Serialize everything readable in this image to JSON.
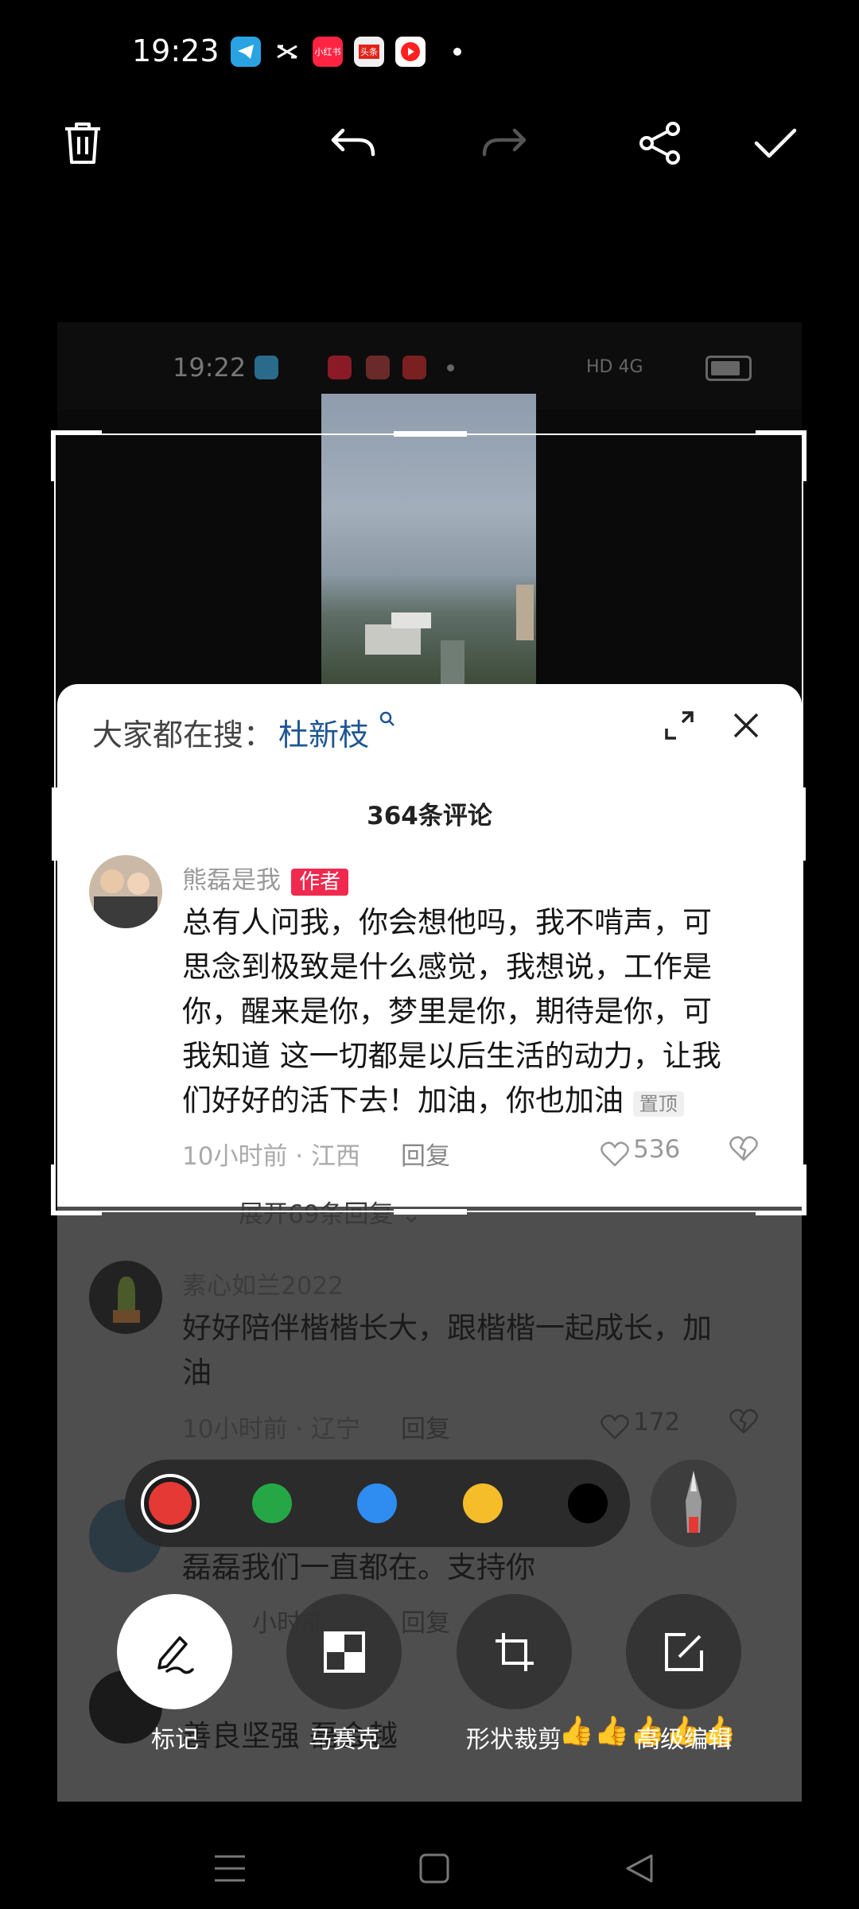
{
  "status_bar": {
    "time": "19:23",
    "icons": [
      "telegram-icon",
      "capcut-icon",
      "xiaohongshu-icon",
      "toutiao-icon",
      "youtube-icon"
    ],
    "xiaohongshu_label": "小红书",
    "toutiao_label": "头条"
  },
  "toolbar": {
    "buttons": [
      "delete-icon",
      "undo-icon",
      "redo-icon",
      "share-icon",
      "done-icon"
    ]
  },
  "screenshot": {
    "status_time": "19:22",
    "status_right": "HD 4G",
    "search_prefix": "大家都在搜：",
    "search_keyword": "杜新枝",
    "comment_count": "364条评论",
    "comments": [
      {
        "username": "熊磊是我",
        "badge": "作者",
        "lines": [
          "总有人问我，你会想他吗，我不啃声，可",
          "思念到极致是什么感觉，我想说，工作是",
          "你，醒来是你，梦里是你，期待是你，可",
          "我知道 这一切都是以后生活的动力，让我",
          "们好好的活下去！加油，你也加油"
        ],
        "pin": "置顶",
        "time_loc": "10小时前 · 江西",
        "reply": "回复",
        "likes": "536"
      }
    ],
    "expand_replies": "展开69条回复",
    "comment2": {
      "username": "素心如兰2022",
      "lines": [
        "好好陪伴楷楷长大，跟楷楷一起成长，加",
        "油"
      ],
      "time_loc": "10小时前 · 辽宁",
      "reply": "回复",
      "likes": "172"
    },
    "comment3": {
      "text": "磊磊我们一直都在。支持你",
      "time_loc": "小时前",
      "reply": "回复"
    },
    "comment4": {
      "text": "善良坚强   磊会越"
    }
  },
  "palette": {
    "colors": [
      "#e53935",
      "#26a745",
      "#2f8cf0",
      "#f6bd2b",
      "#000000"
    ],
    "selected": "#e53935"
  },
  "bottom_tools": {
    "mark": "标记",
    "mosaic": "马赛克",
    "shape_crop": "形状裁剪",
    "advanced_edit": "高级编辑"
  }
}
